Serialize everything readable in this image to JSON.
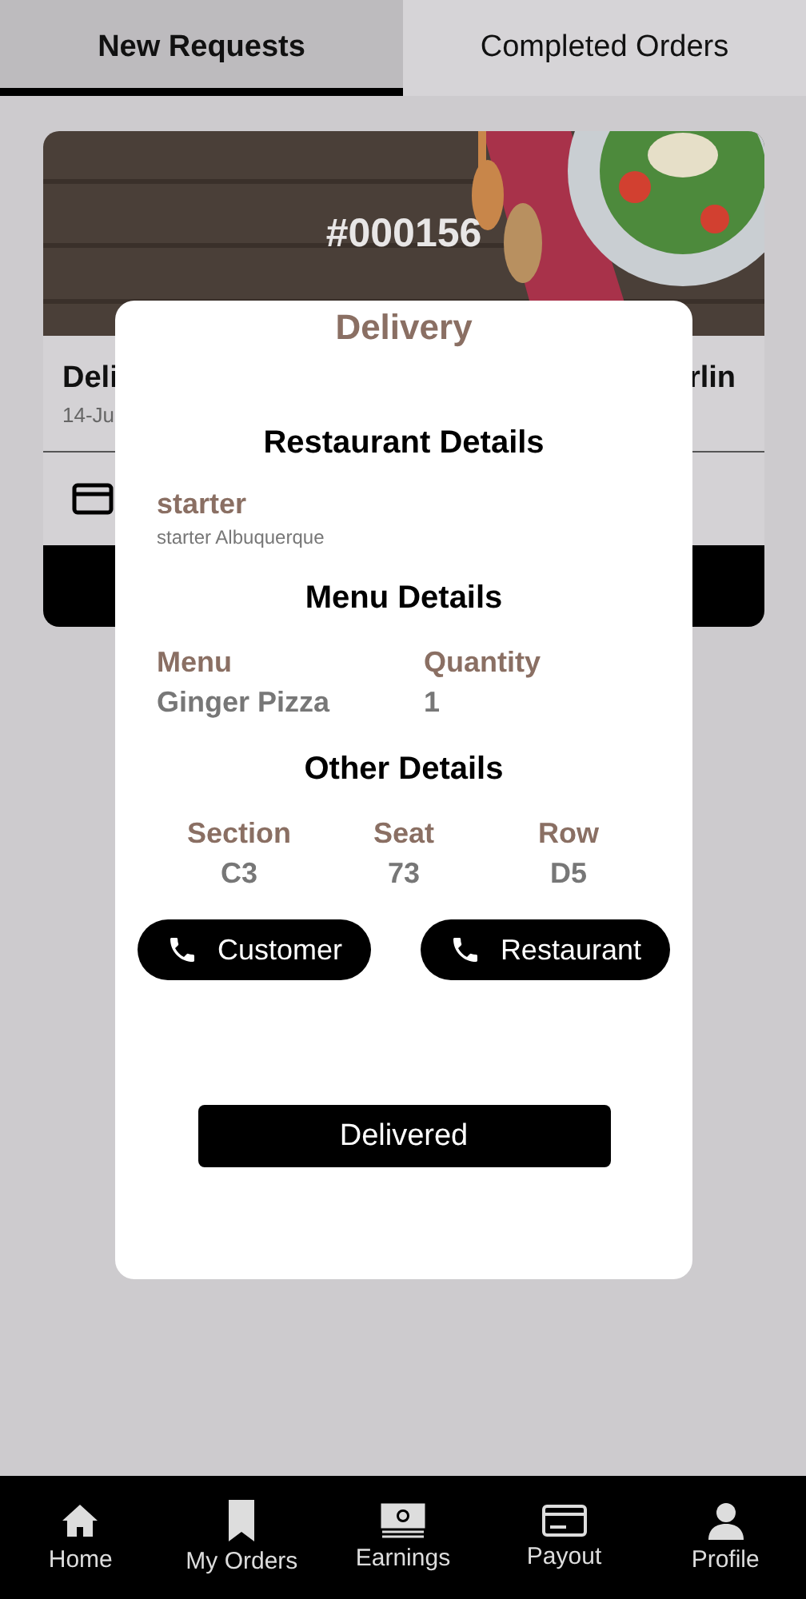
{
  "tabs": [
    {
      "label": "New Requests",
      "selected": true
    },
    {
      "label": "Completed Orders",
      "selected": false
    }
  ],
  "order_card": {
    "order_number": "#000156",
    "title_left": "Deli",
    "title_right": "rlin",
    "date": "14-Ju"
  },
  "modal": {
    "title": "Delivery",
    "restaurant": {
      "heading": "Restaurant Details",
      "name": "starter",
      "address": "starter Albuquerque"
    },
    "menu": {
      "heading": "Menu Details",
      "columns": [
        {
          "label": "Menu",
          "value": "Ginger Pizza"
        },
        {
          "label": "Quantity",
          "value": "1"
        }
      ]
    },
    "other": {
      "heading": "Other Details",
      "columns": [
        {
          "label": "Section",
          "value": "C3"
        },
        {
          "label": "Seat",
          "value": "73"
        },
        {
          "label": "Row",
          "value": "D5"
        }
      ]
    },
    "call_buttons": [
      "Customer",
      "Restaurant"
    ],
    "action": "Delivered"
  },
  "bottom_nav": [
    {
      "label": "Home"
    },
    {
      "label": "My Orders"
    },
    {
      "label": "Earnings"
    },
    {
      "label": "Payout"
    },
    {
      "label": "Profile"
    }
  ]
}
